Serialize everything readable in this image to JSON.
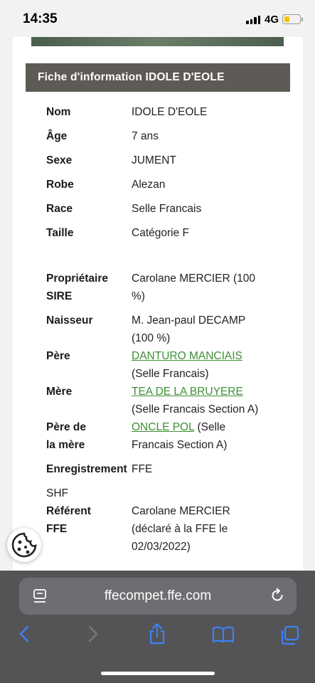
{
  "status_bar": {
    "time": "14:35",
    "network": "4G"
  },
  "header": {
    "title": "Fiche d'information IDOLE D'EOLE"
  },
  "fields": {
    "nom": {
      "label": "Nom",
      "value": "IDOLE D'EOLE"
    },
    "age": {
      "label": "Âge",
      "value": "7 ans"
    },
    "sexe": {
      "label": "Sexe",
      "value": "JUMENT"
    },
    "robe": {
      "label": "Robe",
      "value": "Alezan"
    },
    "race": {
      "label": "Race",
      "value": "Selle Francais"
    },
    "taille": {
      "label": "Taille",
      "value": "Catégorie F"
    },
    "proprietaire": {
      "label_1": "Propriétaire",
      "label_2": "SIRE",
      "value_1": "Carolane MERCIER (100",
      "value_2": "%)"
    },
    "naisseur": {
      "label": "Naisseur",
      "value_1": "M. Jean-paul DECAMP",
      "value_2": "(100 %)"
    },
    "pere": {
      "label": "Père",
      "link": "DANTURO MANCIAIS",
      "value_2": "(Selle Francais)"
    },
    "mere": {
      "label": "Mère",
      "link": "TEA DE LA BRUYERE",
      "value_2": "(Selle Francais Section A)"
    },
    "pere_mere": {
      "label_1": "Père de",
      "label_2": "la mère",
      "link": "ONCLE POL",
      "value_1_suffix": " (Selle",
      "value_2": "Francais Section A)"
    },
    "enregistrement": {
      "label": "Enregistrement",
      "value": "FFE",
      "value_2": "SHF"
    },
    "referent": {
      "label_1": "Référent",
      "label_2": "FFE",
      "value_1": "Carolane MERCIER",
      "value_2": "(déclaré à la FFE le",
      "value_3": "02/03/2022)"
    }
  },
  "browser": {
    "url": "ffecompet.ffe.com"
  },
  "colors": {
    "header_bg": "#5e5a55",
    "link": "#3e8e35",
    "toolbar_bg": "#545457",
    "toolbar_icon": "#3b82f6"
  }
}
